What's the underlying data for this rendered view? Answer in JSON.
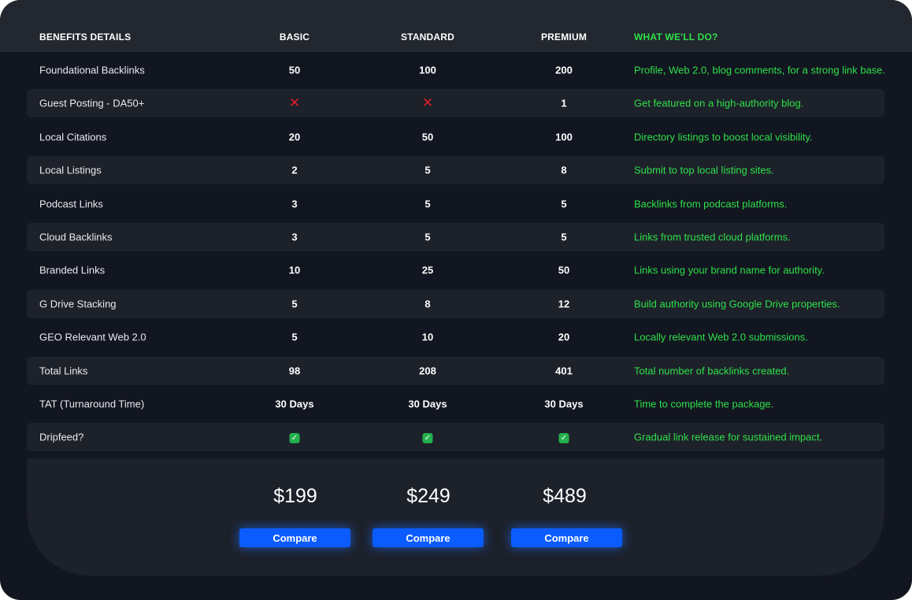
{
  "colors": {
    "background": "#121620",
    "header": "#23272f",
    "accent_green": "#2fe04a",
    "button_blue": "#0a5cff",
    "cross_red": "#e21c2c"
  },
  "header": {
    "benefits": "BENEFITS DETAILS",
    "basic": "BASIC",
    "standard": "STANDARD",
    "premium": "PREMIUM",
    "what": "WHAT WE'LL DO?"
  },
  "rows": [
    {
      "label": "Foundational Backlinks",
      "basic": "50",
      "standard": "100",
      "premium": "200",
      "desc": "Profile, Web 2.0, blog comments, for a strong link base."
    },
    {
      "label": "Guest Posting - DA50+",
      "basic": "cross-icon",
      "standard": "cross-icon",
      "premium": "1",
      "desc": "Get featured on a high-authority blog."
    },
    {
      "label": "Local Citations",
      "basic": "20",
      "standard": "50",
      "premium": "100",
      "desc": "Directory listings to boost local visibility."
    },
    {
      "label": "Local Listings",
      "basic": "2",
      "standard": "5",
      "premium": "8",
      "desc": "Submit to top local listing sites."
    },
    {
      "label": "Podcast Links",
      "basic": "3",
      "standard": "5",
      "premium": "5",
      "desc": "Backlinks from podcast platforms."
    },
    {
      "label": "Cloud Backlinks",
      "basic": "3",
      "standard": "5",
      "premium": "5",
      "desc": "Links from trusted cloud platforms."
    },
    {
      "label": "Branded Links",
      "basic": "10",
      "standard": "25",
      "premium": "50",
      "desc": "Links using your brand name for authority."
    },
    {
      "label": "G Drive Stacking",
      "basic": "5",
      "standard": "8",
      "premium": "12",
      "desc": "Build authority using Google Drive properties."
    },
    {
      "label": "GEO Relevant Web 2.0",
      "basic": "5",
      "standard": "10",
      "premium": "20",
      "desc": "Locally relevant Web 2.0 submissions."
    },
    {
      "label": "Total Links",
      "basic": "98",
      "standard": "208",
      "premium": "401",
      "desc": "Total number of backlinks created."
    },
    {
      "label": "TAT (Turnaround Time)",
      "basic": "30 Days",
      "standard": "30 Days",
      "premium": "30 Days",
      "desc": "Time to complete the package."
    },
    {
      "label": "Dripfeed?",
      "basic": "check-icon",
      "standard": "check-icon",
      "premium": "check-icon",
      "desc": "Gradual link release for sustained impact."
    }
  ],
  "footer": {
    "basic_price": "$199",
    "standard_price": "$249",
    "premium_price": "$489",
    "compare_label": "Compare"
  }
}
